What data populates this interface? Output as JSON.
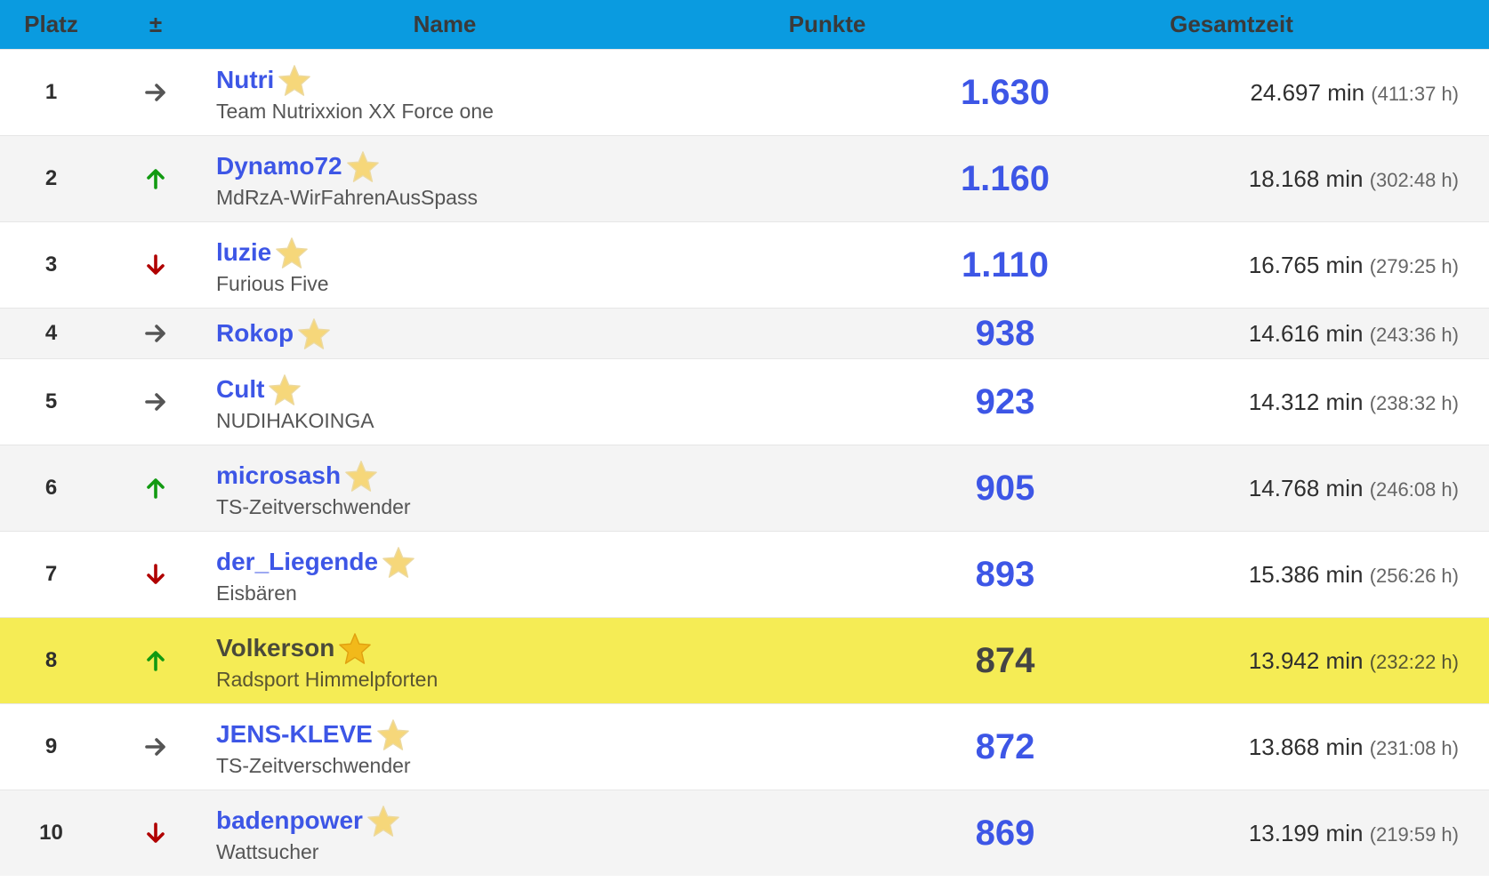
{
  "header": {
    "rank": "Platz",
    "trend": "±",
    "name": "Name",
    "points": "Punkte",
    "total_time": "Gesamtzeit"
  },
  "colors": {
    "header_bg": "#0a9be0",
    "link": "#3d56e6",
    "highlight_row": "#f5ec55",
    "trend_up": "#119a11",
    "trend_down": "#b00000",
    "trend_same": "#555555",
    "star": "#f6d77a"
  },
  "rows": [
    {
      "rank": "1",
      "trend": "same",
      "trend_icon": "arrow-right-icon",
      "name": "Nutri",
      "team": "Team Nutrixxion XX Force one",
      "points": "1.630",
      "time": "24.697 min",
      "hours": "(411:37 h)",
      "highlight": false
    },
    {
      "rank": "2",
      "trend": "up",
      "trend_icon": "arrow-up-icon",
      "name": "Dynamo72",
      "team": "MdRzA-WirFahrenAusSpass",
      "points": "1.160",
      "time": "18.168 min",
      "hours": "(302:48 h)",
      "highlight": false
    },
    {
      "rank": "3",
      "trend": "down",
      "trend_icon": "arrow-down-icon",
      "name": "luzie",
      "team": "Furious Five",
      "points": "1.110",
      "time": "16.765 min",
      "hours": "(279:25 h)",
      "highlight": false
    },
    {
      "rank": "4",
      "trend": "same",
      "trend_icon": "arrow-right-icon",
      "name": "Rokop",
      "team": "",
      "points": "938",
      "time": "14.616 min",
      "hours": "(243:36 h)",
      "highlight": false
    },
    {
      "rank": "5",
      "trend": "same",
      "trend_icon": "arrow-right-icon",
      "name": "Cult",
      "team": "NUDIHAKOINGA",
      "points": "923",
      "time": "14.312 min",
      "hours": "(238:32 h)",
      "highlight": false
    },
    {
      "rank": "6",
      "trend": "up",
      "trend_icon": "arrow-up-icon",
      "name": "microsash",
      "team": "TS-Zeitverschwender",
      "points": "905",
      "time": "14.768 min",
      "hours": "(246:08 h)",
      "highlight": false
    },
    {
      "rank": "7",
      "trend": "down",
      "trend_icon": "arrow-down-icon",
      "name": "der_Liegende",
      "team": "Eisbären",
      "points": "893",
      "time": "15.386 min",
      "hours": "(256:26 h)",
      "highlight": false
    },
    {
      "rank": "8",
      "trend": "up",
      "trend_icon": "arrow-up-icon",
      "name": "Volkerson",
      "team": "Radsport Himmelpforten",
      "points": "874",
      "time": "13.942 min",
      "hours": "(232:22 h)",
      "highlight": true
    },
    {
      "rank": "9",
      "trend": "same",
      "trend_icon": "arrow-right-icon",
      "name": "JENS-KLEVE",
      "team": "TS-Zeitverschwender",
      "points": "872",
      "time": "13.868 min",
      "hours": "(231:08 h)",
      "highlight": false
    },
    {
      "rank": "10",
      "trend": "down",
      "trend_icon": "arrow-down-icon",
      "name": "badenpower",
      "team": "Wattsucher",
      "points": "869",
      "time": "13.199 min",
      "hours": "(219:59 h)",
      "highlight": false
    }
  ]
}
